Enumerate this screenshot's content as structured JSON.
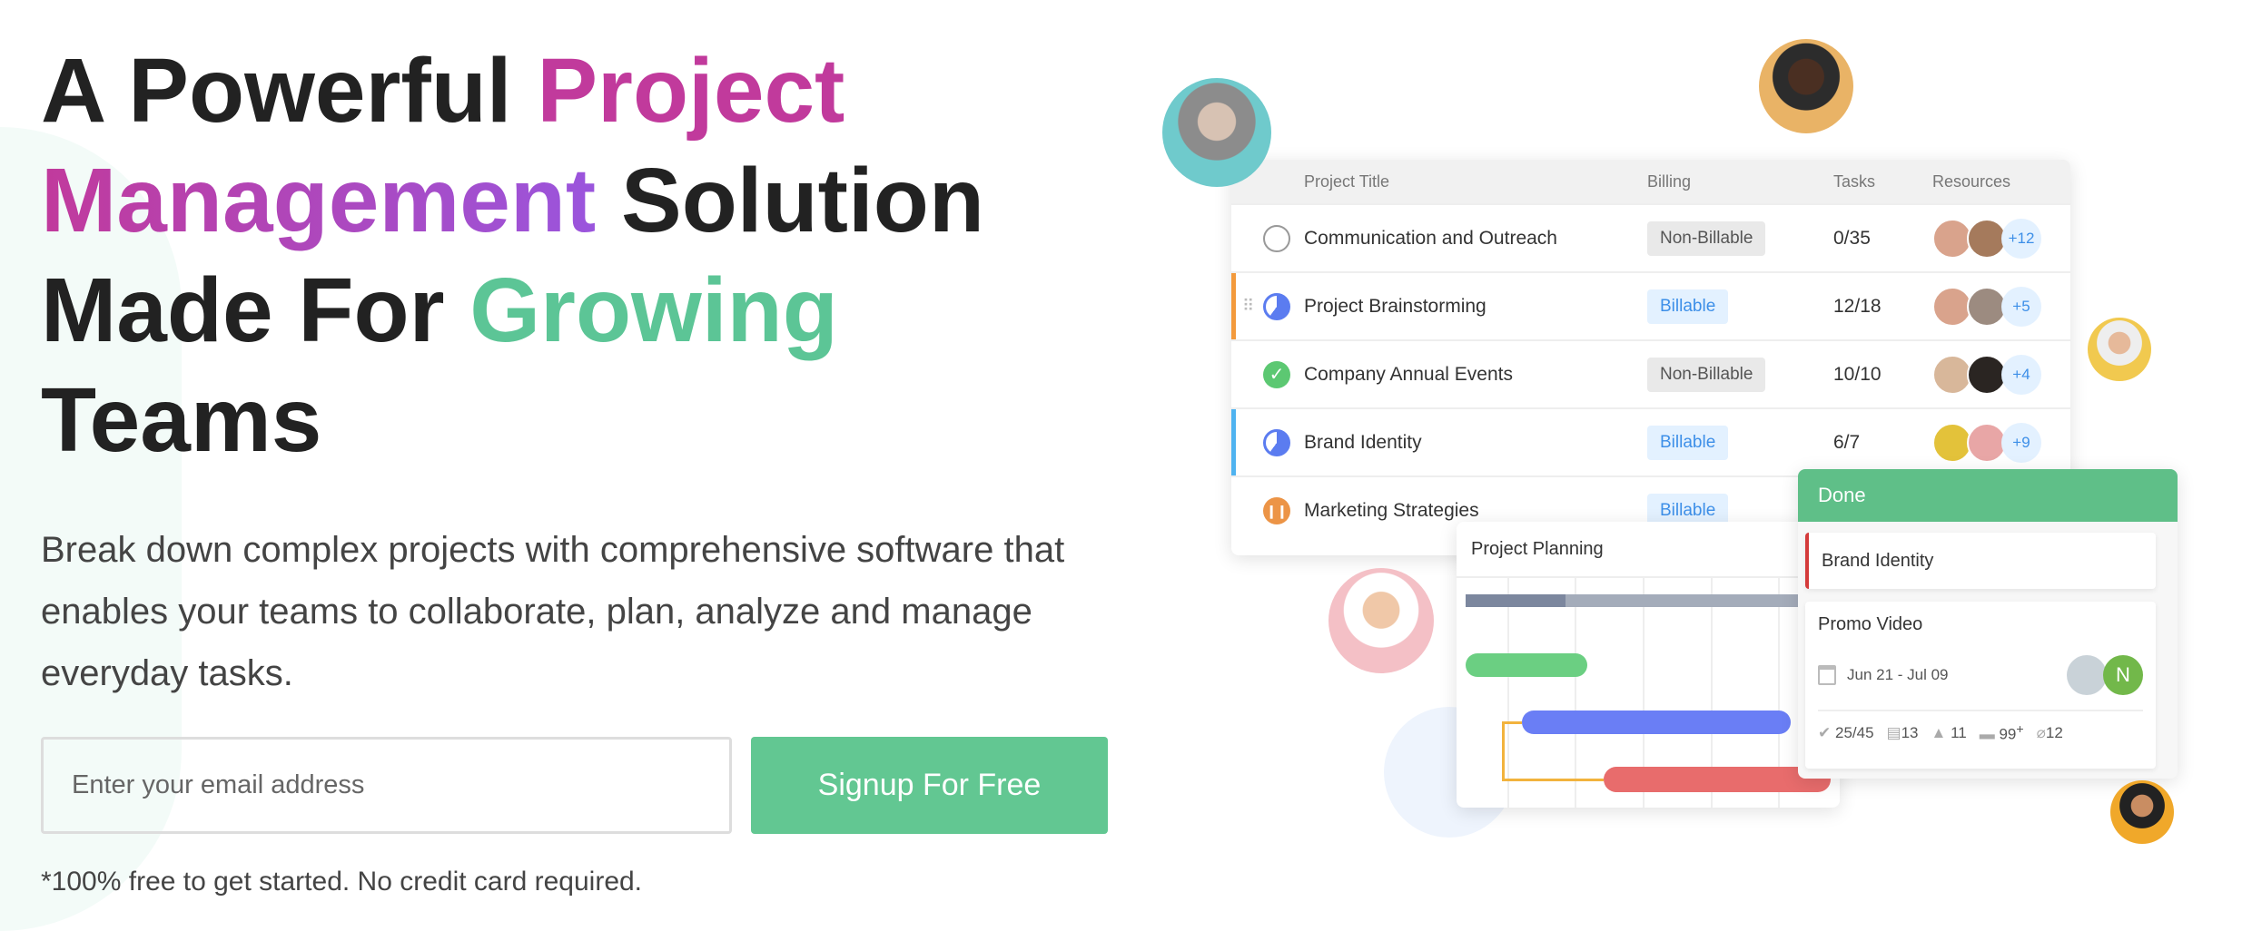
{
  "hero": {
    "title_parts": [
      "A Powerful ",
      "Project",
      "Management",
      " Solution",
      "Made For ",
      "Growing",
      "Teams"
    ],
    "description": "Break down complex projects with comprehensive software that enables your teams to collaborate, plan, analyze and manage everyday tasks.",
    "email_placeholder": "Enter your email address",
    "signup_label": "Signup For Free",
    "note": "*100% free to get started. No credit card required."
  },
  "colors": {
    "pink": "#c13a9c",
    "purple": "#9a55dd",
    "green": "#5cc596",
    "button": "#62c792"
  },
  "projects": {
    "headers": {
      "title": "Project Title",
      "billing": "Billing",
      "tasks": "Tasks",
      "resources": "Resources"
    },
    "rows": [
      {
        "title": "Communication and Outreach",
        "billing": "Non-Billable",
        "tasks": "0/35",
        "more": "+12",
        "status": "not-started"
      },
      {
        "title": "Project Brainstorming",
        "billing": "Billable",
        "tasks": "12/18",
        "more": "+5",
        "status": "in-progress"
      },
      {
        "title": "Company Annual Events",
        "billing": "Non-Billable",
        "tasks": "10/10",
        "more": "+4",
        "status": "completed"
      },
      {
        "title": "Brand Identity",
        "billing": "Billable",
        "tasks": "6/7",
        "more": "+9",
        "status": "in-progress"
      },
      {
        "title": "Marketing Strategies",
        "billing": "Billable",
        "tasks": "",
        "more": "",
        "status": "paused"
      }
    ]
  },
  "gantt": {
    "title": "Project Planning"
  },
  "board": {
    "column": "Done",
    "cards": [
      {
        "title": "Brand Identity"
      },
      {
        "title": "Promo Video",
        "dates": "Jun 21 - Jul 09",
        "avatar_initial": "N",
        "stats": {
          "checklist": "25/45",
          "notes": "13",
          "issues": "11",
          "comments": "99",
          "comments_sup": "+",
          "attachments": "12"
        }
      }
    ]
  }
}
